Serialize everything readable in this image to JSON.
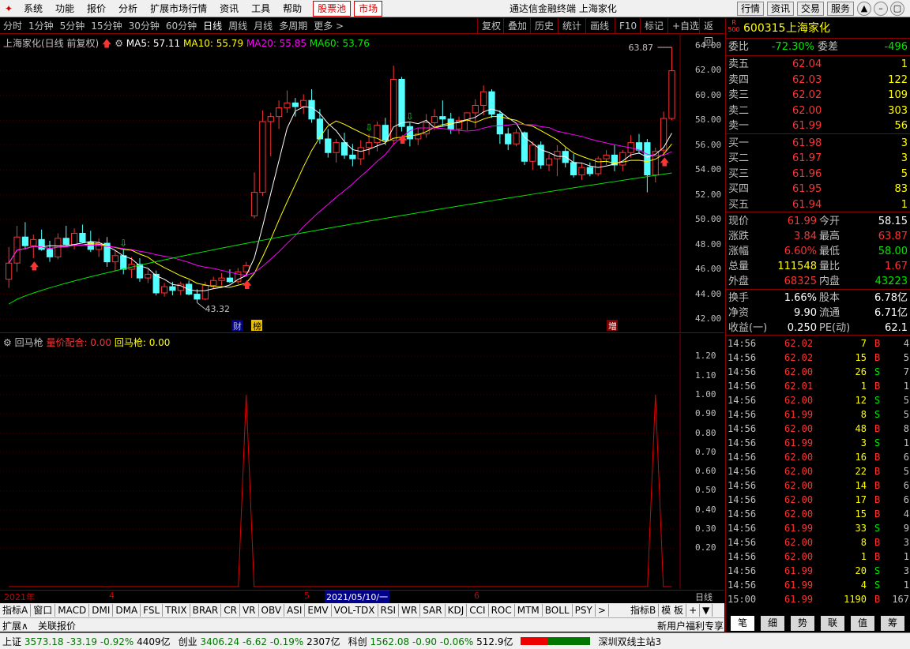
{
  "menu": {
    "logo": "✦",
    "items": [
      "系统",
      "功能",
      "报价",
      "分析",
      "扩展市场行情",
      "资讯",
      "工具",
      "帮助"
    ],
    "red_items": [
      "股票池",
      "市场"
    ],
    "title": "通达信金融终端 上海家化",
    "right_buttons": [
      "行情",
      "资讯",
      "交易",
      "服务"
    ],
    "window_buttons": [
      "▲",
      "–",
      "▢",
      "✕"
    ]
  },
  "periods": {
    "items": [
      "分时",
      "1分钟",
      "5分钟",
      "15分钟",
      "30分钟",
      "60分钟",
      "日线",
      "周线",
      "月线",
      "多周期",
      "更多 >"
    ],
    "active": "日线"
  },
  "toolbar": [
    "复权",
    "叠加",
    "历史",
    "统计",
    "画线",
    "F10",
    "标记",
    "+自选",
    "返回"
  ],
  "main_chart": {
    "stock_label": "上海家化(日线 前复权)",
    "ma5": "MA5: 57.11",
    "ma10": "MA10: 55.79",
    "ma20": "MA20: 55.85",
    "ma60": "MA60: 53.76",
    "high_label": "63.87",
    "low_label": "43.32",
    "markers": [
      "财",
      "榜",
      "增"
    ],
    "colors": {
      "ma5": "#ffffff",
      "ma10": "#ffff00",
      "ma20": "#ff00ff",
      "ma60": "#00e600",
      "up": "#ff3232",
      "down": "#54ffff"
    }
  },
  "ind_chart": {
    "name": "回马枪",
    "val1": "量价配合: 0.00",
    "val2": "回马枪: 0.00"
  },
  "chart_data": [
    {
      "type": "candlestick",
      "title": "上海家化(日线 前复权)",
      "ylim": [
        42,
        64
      ],
      "yticks": [
        "64.00",
        "62.00",
        "60.00",
        "58.00",
        "56.00",
        "54.00",
        "52.00",
        "50.00",
        "48.00",
        "46.00",
        "44.00",
        "42.00"
      ],
      "candles": [
        {
          "o": 45.2,
          "h": 47.8,
          "l": 44.5,
          "c": 46.5
        },
        {
          "o": 46.5,
          "h": 49.5,
          "l": 45.8,
          "c": 48.6
        },
        {
          "o": 48.6,
          "h": 49.8,
          "l": 47.6,
          "c": 47.9
        },
        {
          "o": 47.9,
          "h": 48.8,
          "l": 46.9,
          "c": 48.4
        },
        {
          "o": 48.4,
          "h": 49.2,
          "l": 47.5,
          "c": 47.6
        },
        {
          "o": 47.6,
          "h": 48.3,
          "l": 46.6,
          "c": 47.0
        },
        {
          "o": 47.0,
          "h": 48.9,
          "l": 46.8,
          "c": 48.5
        },
        {
          "o": 48.5,
          "h": 49.5,
          "l": 47.9,
          "c": 48.0
        },
        {
          "o": 48.0,
          "h": 49.3,
          "l": 47.6,
          "c": 48.9
        },
        {
          "o": 48.9,
          "h": 49.6,
          "l": 48.1,
          "c": 48.2
        },
        {
          "o": 48.2,
          "h": 49.1,
          "l": 47.4,
          "c": 47.6
        },
        {
          "o": 47.6,
          "h": 48.5,
          "l": 47.0,
          "c": 48.1
        },
        {
          "o": 48.1,
          "h": 48.6,
          "l": 46.2,
          "c": 46.6
        },
        {
          "o": 46.6,
          "h": 47.5,
          "l": 45.8,
          "c": 47.1
        },
        {
          "o": 47.1,
          "h": 47.6,
          "l": 45.6,
          "c": 46.0
        },
        {
          "o": 46.0,
          "h": 47.0,
          "l": 45.3,
          "c": 46.4
        },
        {
          "o": 46.4,
          "h": 46.9,
          "l": 45.0,
          "c": 45.3
        },
        {
          "o": 45.3,
          "h": 46.0,
          "l": 44.9,
          "c": 45.6
        },
        {
          "o": 45.6,
          "h": 45.9,
          "l": 43.9,
          "c": 44.1
        },
        {
          "o": 44.1,
          "h": 44.9,
          "l": 43.8,
          "c": 44.6
        },
        {
          "o": 44.6,
          "h": 45.0,
          "l": 43.9,
          "c": 44.3
        },
        {
          "o": 44.3,
          "h": 45.0,
          "l": 43.9,
          "c": 44.8
        },
        {
          "o": 44.8,
          "h": 45.1,
          "l": 43.9,
          "c": 44.0
        },
        {
          "o": 44.0,
          "h": 44.4,
          "l": 43.32,
          "c": 43.6
        },
        {
          "o": 43.6,
          "h": 45.0,
          "l": 43.5,
          "c": 44.7
        },
        {
          "o": 44.7,
          "h": 45.4,
          "l": 44.4,
          "c": 45.1
        },
        {
          "o": 45.1,
          "h": 45.7,
          "l": 44.7,
          "c": 45.3
        },
        {
          "o": 45.3,
          "h": 46.0,
          "l": 44.9,
          "c": 45.0
        },
        {
          "o": 45.0,
          "h": 46.1,
          "l": 44.8,
          "c": 45.8
        },
        {
          "o": 45.8,
          "h": 46.6,
          "l": 45.4,
          "c": 46.3
        },
        {
          "o": 50.3,
          "h": 53.8,
          "l": 50.1,
          "c": 52.2
        },
        {
          "o": 52.2,
          "h": 58.8,
          "l": 51.9,
          "c": 57.9
        },
        {
          "o": 57.9,
          "h": 58.6,
          "l": 55.1,
          "c": 58.3
        },
        {
          "o": 58.3,
          "h": 59.6,
          "l": 57.3,
          "c": 59.0
        },
        {
          "o": 59.0,
          "h": 60.4,
          "l": 58.6,
          "c": 59.4
        },
        {
          "o": 59.4,
          "h": 59.8,
          "l": 58.3,
          "c": 59.1
        },
        {
          "o": 59.1,
          "h": 60.1,
          "l": 58.5,
          "c": 59.6
        },
        {
          "o": 59.6,
          "h": 60.5,
          "l": 57.8,
          "c": 58.1
        },
        {
          "o": 58.1,
          "h": 58.9,
          "l": 56.1,
          "c": 56.5
        },
        {
          "o": 56.5,
          "h": 57.3,
          "l": 55.0,
          "c": 55.4
        },
        {
          "o": 55.4,
          "h": 56.5,
          "l": 54.6,
          "c": 56.2
        },
        {
          "o": 56.2,
          "h": 57.0,
          "l": 54.9,
          "c": 55.2
        },
        {
          "o": 55.2,
          "h": 56.1,
          "l": 54.3,
          "c": 54.9
        },
        {
          "o": 54.9,
          "h": 56.4,
          "l": 54.4,
          "c": 55.8
        },
        {
          "o": 55.8,
          "h": 56.9,
          "l": 55.2,
          "c": 56.2
        },
        {
          "o": 56.2,
          "h": 57.9,
          "l": 55.5,
          "c": 57.6
        },
        {
          "o": 57.6,
          "h": 58.2,
          "l": 56.0,
          "c": 56.4
        },
        {
          "o": 56.4,
          "h": 62.4,
          "l": 56.0,
          "c": 61.3
        },
        {
          "o": 61.3,
          "h": 61.5,
          "l": 57.1,
          "c": 57.5
        },
        {
          "o": 57.5,
          "h": 57.8,
          "l": 55.9,
          "c": 56.5
        },
        {
          "o": 56.5,
          "h": 57.4,
          "l": 56.0,
          "c": 56.9
        },
        {
          "o": 56.9,
          "h": 58.5,
          "l": 56.6,
          "c": 57.8
        },
        {
          "o": 57.8,
          "h": 58.9,
          "l": 57.2,
          "c": 58.3
        },
        {
          "o": 58.3,
          "h": 59.6,
          "l": 57.5,
          "c": 58.1
        },
        {
          "o": 58.1,
          "h": 58.6,
          "l": 56.9,
          "c": 57.3
        },
        {
          "o": 57.3,
          "h": 58.3,
          "l": 56.9,
          "c": 58.0
        },
        {
          "o": 58.0,
          "h": 58.4,
          "l": 57.2,
          "c": 58.6
        },
        {
          "o": 58.6,
          "h": 59.7,
          "l": 57.4,
          "c": 59.2
        },
        {
          "o": 59.2,
          "h": 60.8,
          "l": 58.4,
          "c": 60.3
        },
        {
          "o": 60.3,
          "h": 60.5,
          "l": 58.2,
          "c": 58.5
        },
        {
          "o": 58.5,
          "h": 58.8,
          "l": 56.1,
          "c": 56.9
        },
        {
          "o": 56.9,
          "h": 57.4,
          "l": 55.6,
          "c": 56.1
        },
        {
          "o": 56.1,
          "h": 57.3,
          "l": 55.9,
          "c": 57.0
        },
        {
          "o": 57.0,
          "h": 57.1,
          "l": 54.4,
          "c": 54.7
        },
        {
          "o": 54.7,
          "h": 56.3,
          "l": 54.0,
          "c": 56.0
        },
        {
          "o": 56.0,
          "h": 56.3,
          "l": 54.1,
          "c": 54.4
        },
        {
          "o": 54.4,
          "h": 55.3,
          "l": 53.9,
          "c": 54.9
        },
        {
          "o": 54.9,
          "h": 56.0,
          "l": 53.5,
          "c": 55.5
        },
        {
          "o": 55.5,
          "h": 55.8,
          "l": 54.2,
          "c": 54.6
        },
        {
          "o": 54.6,
          "h": 55.3,
          "l": 53.4,
          "c": 53.6
        },
        {
          "o": 53.6,
          "h": 54.6,
          "l": 53.2,
          "c": 54.2
        },
        {
          "o": 54.2,
          "h": 54.6,
          "l": 53.5,
          "c": 53.7
        },
        {
          "o": 53.7,
          "h": 55.1,
          "l": 53.5,
          "c": 54.9
        },
        {
          "o": 54.9,
          "h": 55.6,
          "l": 54.4,
          "c": 55.2
        },
        {
          "o": 55.2,
          "h": 56.0,
          "l": 53.9,
          "c": 54.4
        },
        {
          "o": 54.4,
          "h": 55.6,
          "l": 53.9,
          "c": 55.4
        },
        {
          "o": 55.4,
          "h": 56.8,
          "l": 55.0,
          "c": 56.2
        },
        {
          "o": 56.2,
          "h": 56.9,
          "l": 55.3,
          "c": 55.6
        },
        {
          "o": 56.2,
          "h": 56.5,
          "l": 52.2,
          "c": 53.6
        },
        {
          "o": 53.6,
          "h": 55.8,
          "l": 53.0,
          "c": 55.5
        },
        {
          "o": 55.6,
          "h": 58.7,
          "l": 55.3,
          "c": 58.15
        },
        {
          "o": 58.15,
          "h": 63.87,
          "l": 58.0,
          "c": 61.99
        }
      ],
      "ma5_note": "moving averages drawn from candle closes"
    },
    {
      "type": "line",
      "title": "回马枪",
      "ylim": [
        0,
        1.3
      ],
      "yticks": [
        "1.20",
        "1.10",
        "1.00",
        "0.90",
        "0.80",
        "0.70",
        "0.60",
        "0.50",
        "0.40",
        "0.30",
        "0.20"
      ],
      "series": [
        {
          "name": "量价配合",
          "spikes_at_index": [
            29,
            79
          ],
          "values_note": "0 elsewhere, 1.0 at spikes"
        }
      ]
    }
  ],
  "date_bar": {
    "labels": [
      "2021年",
      "4",
      "5",
      "2021/05/10/一",
      "6"
    ],
    "right": "日线"
  },
  "tabs": [
    "指标A",
    "窗口",
    "MACD",
    "DMI",
    "DMA",
    "FSL",
    "TRIX",
    "BRAR",
    "CR",
    "VR",
    "OBV",
    "ASI",
    "EMV",
    "VOL-TDX",
    "RSI",
    "WR",
    "SAR",
    "KDJ",
    "CCI",
    "ROC",
    "MTM",
    "BOLL",
    "PSY",
    ">"
  ],
  "tabs_right": [
    "指标B",
    "模 板",
    "+",
    "▼"
  ],
  "subbar": {
    "left": [
      "扩展∧",
      "关联报价"
    ],
    "right": "新用户福利专享"
  },
  "status": {
    "sh_name": "上证",
    "sh_val": "3573.18",
    "sh_chg": "-33.19",
    "sh_pct": "-0.92%",
    "sh_amt": "4409亿",
    "cy_name": "创业",
    "cy_val": "3406.24",
    "cy_chg": "-6.62",
    "cy_pct": "-0.19%",
    "cy_amt": "2307亿",
    "kc_name": "科创",
    "kc_val": "1562.08",
    "kc_chg": "-0.90",
    "kc_pct": "-0.06%",
    "kc_amt": "512.9亿",
    "server": "深圳双线主站3"
  },
  "quote": {
    "code": "600315",
    "name": "上海家化",
    "badge": "R 500",
    "weibi_label": "委比",
    "weibi": "-72.30%",
    "weicha_label": "委差",
    "weicha": "-496",
    "asks": [
      {
        "label": "卖五",
        "price": "62.04",
        "vol": "1"
      },
      {
        "label": "卖四",
        "price": "62.03",
        "vol": "122"
      },
      {
        "label": "卖三",
        "price": "62.02",
        "vol": "109"
      },
      {
        "label": "卖二",
        "price": "62.00",
        "vol": "303"
      },
      {
        "label": "卖一",
        "price": "61.99",
        "vol": "56"
      }
    ],
    "bids": [
      {
        "label": "买一",
        "price": "61.98",
        "vol": "3"
      },
      {
        "label": "买二",
        "price": "61.97",
        "vol": "3"
      },
      {
        "label": "买三",
        "price": "61.96",
        "vol": "5"
      },
      {
        "label": "买四",
        "price": "61.95",
        "vol": "83"
      },
      {
        "label": "买五",
        "price": "61.94",
        "vol": "1"
      }
    ],
    "stats": [
      {
        "l1": "现价",
        "v1": "61.99",
        "c1": "up",
        "l2": "今开",
        "v2": "58.15",
        "c2": "white"
      },
      {
        "l1": "涨跌",
        "v1": "3.84",
        "c1": "up",
        "l2": "最高",
        "v2": "63.87",
        "c2": "up"
      },
      {
        "l1": "涨幅",
        "v1": "6.60%",
        "c1": "up",
        "l2": "最低",
        "v2": "58.00",
        "c2": "dn"
      },
      {
        "l1": "总量",
        "v1": "111548",
        "c1": "yellow",
        "l2": "量比",
        "v2": "1.67",
        "c2": "up"
      },
      {
        "l1": "外盘",
        "v1": "68325",
        "c1": "up",
        "l2": "内盘",
        "v2": "43223",
        "c2": "dn"
      }
    ],
    "stats2": [
      {
        "l1": "换手",
        "v1": "1.66%",
        "l2": "股本",
        "v2": "6.78亿"
      },
      {
        "l1": "净资",
        "v1": "9.90",
        "l2": "流通",
        "v2": "6.71亿"
      },
      {
        "l1": "收益(一)",
        "v1": "0.250",
        "l2": "PE(动)",
        "v2": "62.1"
      }
    ],
    "ticks": [
      {
        "t": "14:56",
        "p": "62.02",
        "v": "7",
        "d": "B",
        "n": "4"
      },
      {
        "t": "14:56",
        "p": "62.02",
        "v": "15",
        "d": "B",
        "n": "5"
      },
      {
        "t": "14:56",
        "p": "62.00",
        "v": "26",
        "d": "S",
        "n": "7"
      },
      {
        "t": "14:56",
        "p": "62.01",
        "v": "1",
        "d": "B",
        "n": "1"
      },
      {
        "t": "14:56",
        "p": "62.00",
        "v": "12",
        "d": "S",
        "n": "5"
      },
      {
        "t": "14:56",
        "p": "61.99",
        "v": "8",
        "d": "S",
        "n": "5"
      },
      {
        "t": "14:56",
        "p": "62.00",
        "v": "48",
        "d": "B",
        "n": "8"
      },
      {
        "t": "14:56",
        "p": "61.99",
        "v": "3",
        "d": "S",
        "n": "1"
      },
      {
        "t": "14:56",
        "p": "62.00",
        "v": "16",
        "d": "B",
        "n": "6"
      },
      {
        "t": "14:56",
        "p": "62.00",
        "v": "22",
        "d": "B",
        "n": "5"
      },
      {
        "t": "14:56",
        "p": "62.00",
        "v": "14",
        "d": "B",
        "n": "6"
      },
      {
        "t": "14:56",
        "p": "62.00",
        "v": "17",
        "d": "B",
        "n": "6"
      },
      {
        "t": "14:56",
        "p": "62.00",
        "v": "15",
        "d": "B",
        "n": "4"
      },
      {
        "t": "14:56",
        "p": "61.99",
        "v": "33",
        "d": "S",
        "n": "9"
      },
      {
        "t": "14:56",
        "p": "62.00",
        "v": "8",
        "d": "B",
        "n": "3"
      },
      {
        "t": "14:56",
        "p": "62.00",
        "v": "1",
        "d": "B",
        "n": "1"
      },
      {
        "t": "14:56",
        "p": "61.99",
        "v": "20",
        "d": "S",
        "n": "3"
      },
      {
        "t": "14:56",
        "p": "61.99",
        "v": "4",
        "d": "S",
        "n": "1"
      },
      {
        "t": "15:00",
        "p": "61.99",
        "v": "1190",
        "d": "B",
        "n": "167"
      }
    ],
    "bottom_tabs": [
      "笔",
      "细",
      "势",
      "联",
      "值",
      "筹"
    ]
  }
}
